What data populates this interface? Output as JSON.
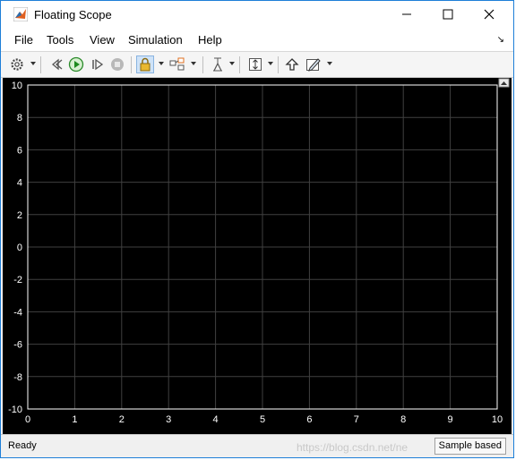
{
  "window": {
    "title": "Floating Scope",
    "app_icon": "matlab-icon"
  },
  "menubar": {
    "items": [
      {
        "label": "File"
      },
      {
        "label": "Tools"
      },
      {
        "label": "View"
      },
      {
        "label": "Simulation"
      },
      {
        "label": "Help"
      }
    ]
  },
  "toolbar": {
    "buttons": [
      "settings-icon",
      "step-back-icon",
      "run-icon",
      "step-forward-icon",
      "stop-icon",
      "lock-icon",
      "signal-select-icon",
      "cursor-measure-icon",
      "scale-axes-icon",
      "highlight-block-icon",
      "edit-style-icon"
    ]
  },
  "chart_data": {
    "type": "line",
    "title": "",
    "xlabel": "",
    "ylabel": "",
    "xlim": [
      0,
      10
    ],
    "ylim": [
      -10,
      10
    ],
    "x_ticks": [
      0,
      1,
      2,
      3,
      4,
      5,
      6,
      7,
      8,
      9,
      10
    ],
    "y_ticks": [
      -10,
      -8,
      -6,
      -4,
      -2,
      0,
      2,
      4,
      6,
      8,
      10
    ],
    "grid": true,
    "series": [],
    "colors": {
      "background": "#000000",
      "axes": "#ffffff",
      "grid": "#404040",
      "tick_label": "#ffffff"
    }
  },
  "status": {
    "left": "Ready",
    "right": "Sample based",
    "watermark": "https://blog.csdn.net/ne"
  }
}
